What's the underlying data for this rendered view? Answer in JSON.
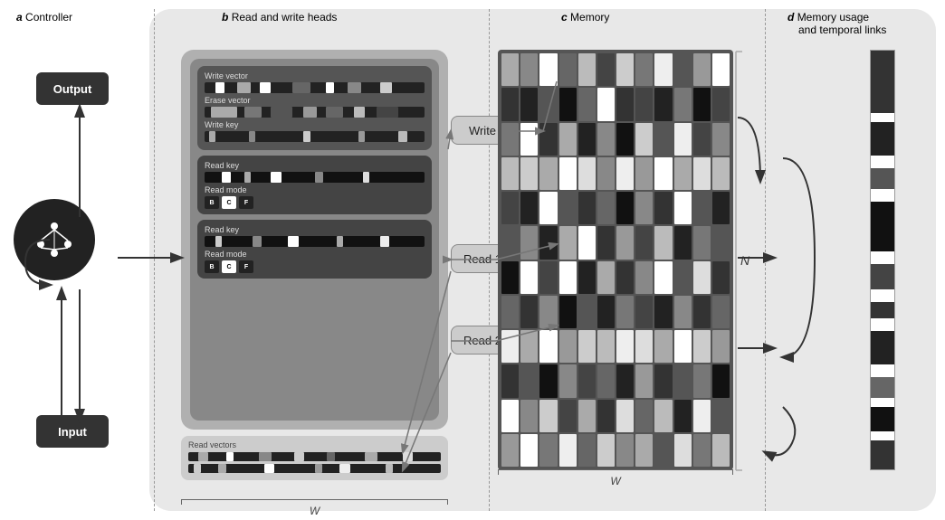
{
  "sections": {
    "a_label": "a",
    "a_title": "Controller",
    "b_label": "b",
    "b_title": "Read and write heads",
    "c_label": "c",
    "c_title": "Memory",
    "d_label": "d",
    "d_title": "Memory usage",
    "d_subtitle": "and temporal links"
  },
  "controller": {
    "output_label": "Output",
    "input_label": "Input"
  },
  "write_head": {
    "write_vector_label": "Write vector",
    "erase_vector_label": "Erase vector",
    "write_key_label": "Write key"
  },
  "read_head1": {
    "read_key_label": "Read key",
    "read_mode_label": "Read mode",
    "modes": [
      "B",
      "C",
      "F"
    ]
  },
  "read_head2": {
    "read_key_label": "Read key",
    "read_mode_label": "Read mode",
    "modes": [
      "B",
      "C",
      "F"
    ]
  },
  "read_vectors": {
    "label": "Read vectors"
  },
  "buttons": {
    "write": "Write",
    "read1": "Read 1",
    "read2": "Read 2"
  },
  "labels": {
    "W": "W",
    "N": "N"
  },
  "colors": {
    "dark_bg": "#333333",
    "medium_bg": "#888888",
    "light_bg": "#cccccc",
    "panel_bg": "#b0b0b0",
    "memory_bg": "#555555"
  }
}
